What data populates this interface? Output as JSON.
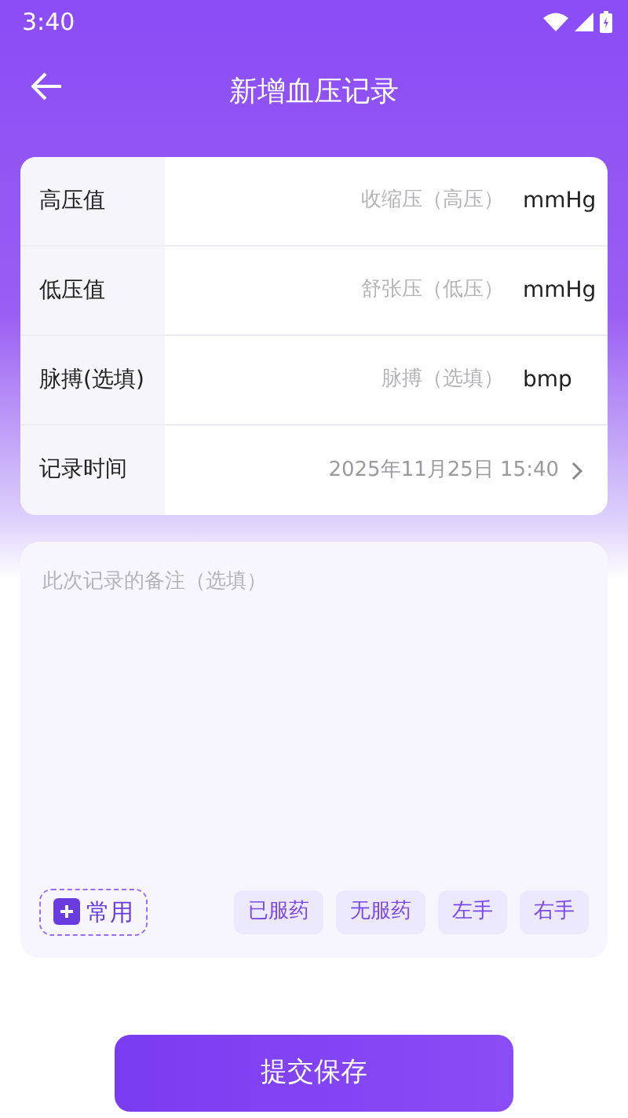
{
  "status_bar": {
    "time": "3:40"
  },
  "header": {
    "title": "新增血压记录"
  },
  "fields": [
    {
      "kind": "unit",
      "label": "高压值",
      "placeholder": "收缩压（高压）",
      "unit": "mmHg"
    },
    {
      "kind": "unit",
      "label": "低压值",
      "placeholder": "舒张压（低压）",
      "unit": "mmHg"
    },
    {
      "kind": "unit",
      "label": "脉搏(选填)",
      "placeholder": "脉搏（选填）",
      "unit": "bmp"
    },
    {
      "kind": "picker",
      "label": "记录时间",
      "value": "2025年11月25日 15:40"
    }
  ],
  "note": {
    "placeholder": "此次记录的备注（选填）",
    "common_button": "常用",
    "tags": [
      "已服药",
      "无服药",
      "左手",
      "右手"
    ]
  },
  "submit_button": "提交保存"
}
